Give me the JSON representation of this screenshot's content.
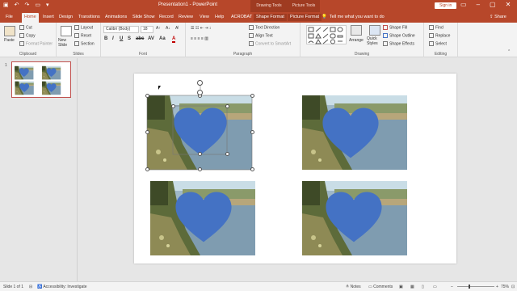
{
  "window": {
    "title": "Presentation1 - PowerPoint",
    "context_groups": [
      "Drawing Tools",
      "Picture Tools"
    ],
    "signin_label": "Sign in"
  },
  "tabs": [
    "File",
    "Home",
    "Insert",
    "Design",
    "Transitions",
    "Animations",
    "Slide Show",
    "Record",
    "Review",
    "View",
    "Help",
    "ACROBAT",
    "Shape Format",
    "Picture Format"
  ],
  "active_tab": "Home",
  "tell_me": "Tell me what you want to do",
  "share_label": "Share",
  "ribbon": {
    "clipboard": {
      "label": "Clipboard",
      "paste": "Paste",
      "cut": "Cut",
      "copy": "Copy",
      "format_painter": "Format Painter"
    },
    "slides": {
      "label": "Slides",
      "new_slide": "New Slide",
      "layout": "Layout",
      "reset": "Reset",
      "section": "Section"
    },
    "font": {
      "label": "Font",
      "font_name": "Calibri (Body)",
      "font_size": "18"
    },
    "paragraph": {
      "label": "Paragraph",
      "text_direction": "Text Direction",
      "align_text": "Align Text",
      "convert_smartart": "Convert to SmartArt"
    },
    "drawing": {
      "label": "Drawing",
      "arrange": "Arrange",
      "quick_styles": "Quick Styles",
      "shape_fill": "Shape Fill",
      "shape_outline": "Shape Outline",
      "shape_effects": "Shape Effects"
    },
    "editing": {
      "label": "Editing",
      "find": "Find",
      "replace": "Replace",
      "select": "Select"
    }
  },
  "thumbnails": [
    {
      "number": "1"
    }
  ],
  "status": {
    "slide_info": "Slide 1 of 1",
    "accessibility": "Accessibility: Investigate",
    "notes": "Notes",
    "comments": "Comments",
    "zoom": "75%"
  },
  "colors": {
    "accent": "#b7472a",
    "heart": "#4472c4"
  }
}
